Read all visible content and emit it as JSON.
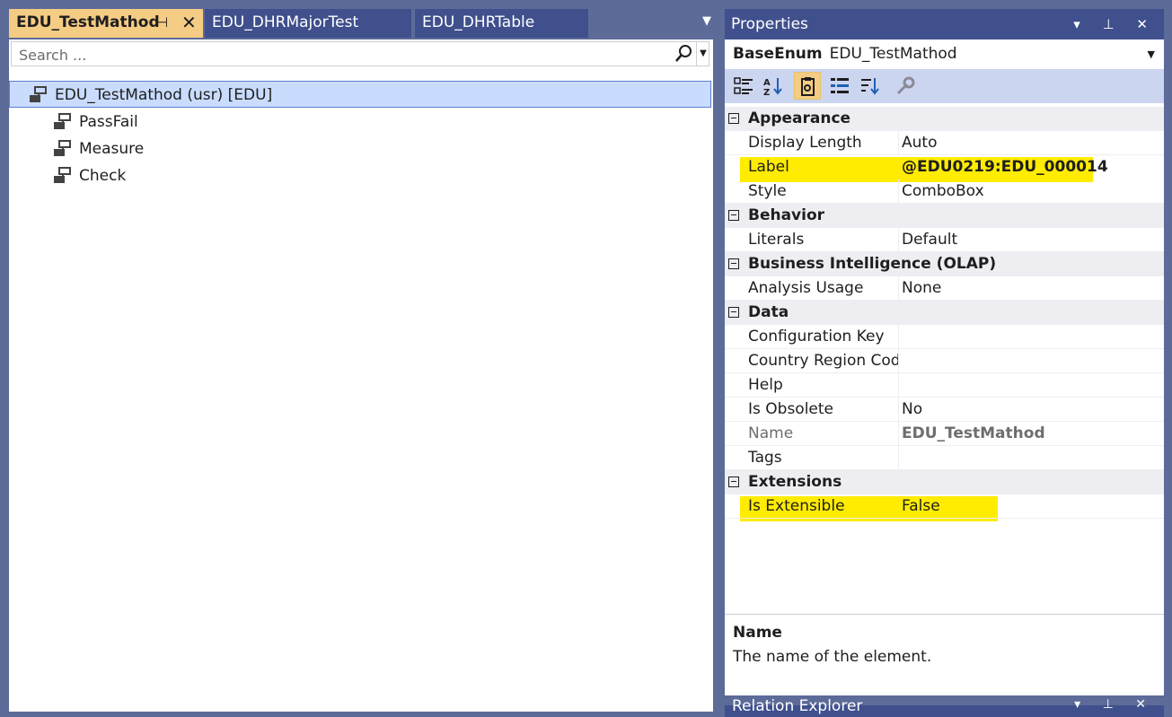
{
  "tabs": [
    {
      "label": "EDU_TestMathod",
      "active": true
    },
    {
      "label": "EDU_DHRMajorTest",
      "active": false
    },
    {
      "label": "EDU_DHRTable",
      "active": false
    }
  ],
  "tab_controls": {
    "pin": "⊣",
    "close": "✕",
    "overflow": "▼"
  },
  "search": {
    "placeholder": "Search ...",
    "value": ""
  },
  "tree": {
    "root": {
      "label": "EDU_TestMathod (usr) [EDU]",
      "icon": "base-enum-icon"
    },
    "children": [
      {
        "label": "PassFail",
        "icon": "enum-value-icon"
      },
      {
        "label": "Measure",
        "icon": "enum-value-icon"
      },
      {
        "label": "Check",
        "icon": "enum-value-icon"
      }
    ]
  },
  "properties": {
    "title": "Properties",
    "title_buttons": "▾ ⊥ ✕",
    "object_type": "BaseEnum",
    "object_name": "EDU_TestMathod",
    "dropdown": "▼",
    "toolbar": [
      "categorized-icon",
      "alphabetical-icon",
      "properties-icon",
      "events-icon",
      "sort-icon",
      "wrench-icon"
    ],
    "categories": [
      {
        "name": "Appearance",
        "rows": [
          {
            "name": "Display Length",
            "value": "Auto"
          },
          {
            "name": "Label",
            "value": "@EDU0219:EDU_000014",
            "bold": true,
            "highlight": true
          },
          {
            "name": "Style",
            "value": "ComboBox"
          }
        ]
      },
      {
        "name": "Behavior",
        "rows": [
          {
            "name": "Literals",
            "value": "Default"
          }
        ]
      },
      {
        "name": "Business Intelligence (OLAP)",
        "rows": [
          {
            "name": "Analysis Usage",
            "value": "None"
          }
        ]
      },
      {
        "name": "Data",
        "rows": [
          {
            "name": "Configuration Key",
            "value": ""
          },
          {
            "name": "Country Region Codes",
            "value": ""
          },
          {
            "name": "Help",
            "value": ""
          },
          {
            "name": "Is Obsolete",
            "value": "No"
          },
          {
            "name": "Name",
            "value": "EDU_TestMathod",
            "readonly": true
          },
          {
            "name": "Tags",
            "value": ""
          }
        ]
      },
      {
        "name": "Extensions",
        "rows": [
          {
            "name": "Is Extensible",
            "value": "False",
            "highlight": true
          }
        ]
      }
    ],
    "description": {
      "title": "Name",
      "text": "The name of the element."
    }
  },
  "bottom_panel": {
    "title": "Relation Explorer",
    "buttons": "▾ ⊥ ✕"
  },
  "colors": {
    "accent_tab": "#f5cc84",
    "highlight": "#ffec00",
    "panel_title": "#40508d",
    "selection": "#c9dcfe"
  }
}
